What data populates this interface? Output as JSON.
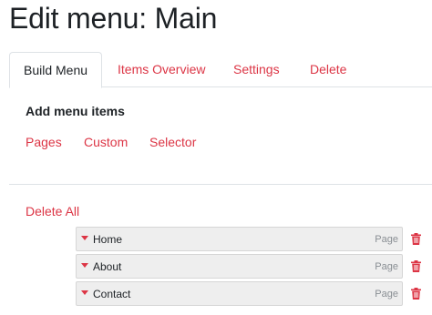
{
  "page": {
    "title": "Edit menu: Main"
  },
  "tabs": [
    {
      "label": "Build Menu",
      "active": true
    },
    {
      "label": "Items Overview",
      "active": false
    },
    {
      "label": "Settings",
      "active": false
    },
    {
      "label": "Delete",
      "active": false
    }
  ],
  "add_section": {
    "title": "Add menu items",
    "links": [
      "Pages",
      "Custom",
      "Selector"
    ]
  },
  "menu": {
    "delete_all_label": "Delete All",
    "items": [
      {
        "label": "Home",
        "type": "Page"
      },
      {
        "label": "About",
        "type": "Page"
      },
      {
        "label": "Contact",
        "type": "Page"
      }
    ]
  },
  "colors": {
    "accent": "#dc3545",
    "text": "#1d2125",
    "item_bg": "#eeeeee",
    "border": "#dee2e6"
  },
  "icons": {
    "caret": "caret-down-icon",
    "delete": "trash-icon"
  }
}
